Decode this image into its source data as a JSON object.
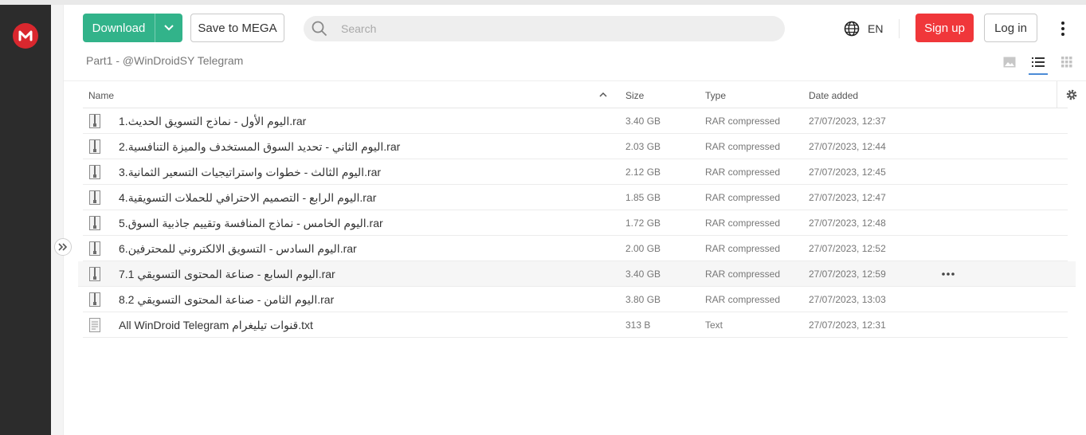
{
  "brand": {
    "logo_letter": "M",
    "color": "#d9272e"
  },
  "toolbar": {
    "download_label": "Download",
    "save_label": "Save to MEGA",
    "search_placeholder": "Search",
    "language": "EN",
    "signup_label": "Sign up",
    "login_label": "Log in"
  },
  "colors": {
    "download": "#32b38a",
    "signup": "#f0373a",
    "sidebar": "#2c2c2c",
    "active_view": "#4c8bd6"
  },
  "breadcrumb": "Part1 - @WinDroidSY Telegram",
  "table": {
    "headers": {
      "name": "Name",
      "size": "Size",
      "type": "Type",
      "date": "Date added"
    },
    "rows": [
      {
        "name": "1.اليوم الأول - نماذج التسويق الحديث.rar",
        "size": "3.40 GB",
        "type": "RAR compressed",
        "date": "27/07/2023, 12:37",
        "icon": "archive-icon"
      },
      {
        "name": "2.اليوم الثاني - تحديد السوق المستخدف والميزة التنافسية.rar",
        "size": "2.03 GB",
        "type": "RAR compressed",
        "date": "27/07/2023, 12:44",
        "icon": "archive-icon"
      },
      {
        "name": "3.اليوم الثالث - خطوات واستراتيجيات التسعير الثمانية.rar",
        "size": "2.12 GB",
        "type": "RAR compressed",
        "date": "27/07/2023, 12:45",
        "icon": "archive-icon"
      },
      {
        "name": "4.اليوم الرابع - التصميم الاحترافي للحملات التسويقية.rar",
        "size": "1.85 GB",
        "type": "RAR compressed",
        "date": "27/07/2023, 12:47",
        "icon": "archive-icon"
      },
      {
        "name": "5.اليوم الخامس - نماذج المنافسة وتقييم جاذبية السوق.rar",
        "size": "1.72 GB",
        "type": "RAR compressed",
        "date": "27/07/2023, 12:48",
        "icon": "archive-icon"
      },
      {
        "name": "6.اليوم السادس - التسويق الالكتروني للمحترفين.rar",
        "size": "2.00 GB",
        "type": "RAR compressed",
        "date": "27/07/2023, 12:52",
        "icon": "archive-icon"
      },
      {
        "name": "7.1 اليوم السابع - صناعة المحتوى التسويقي.rar",
        "size": "3.40 GB",
        "type": "RAR compressed",
        "date": "27/07/2023, 12:59",
        "icon": "archive-icon",
        "hover": true
      },
      {
        "name": "8.2 اليوم الثامن - صناعة المحتوى التسويقي.rar",
        "size": "3.80 GB",
        "type": "RAR compressed",
        "date": "27/07/2023, 13:03",
        "icon": "archive-icon"
      },
      {
        "name": "All WinDroid Telegram قنوات تيليغرام.txt",
        "size": "313 B",
        "type": "Text",
        "date": "27/07/2023, 12:31",
        "icon": "text-file-icon"
      }
    ]
  }
}
